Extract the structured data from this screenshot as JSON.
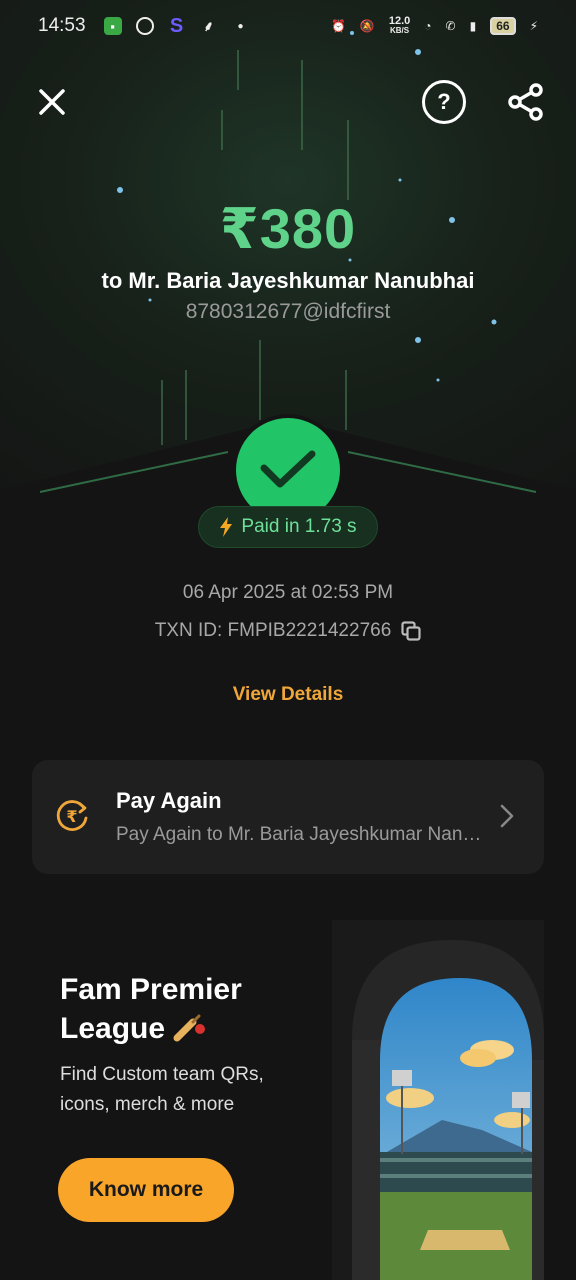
{
  "status_bar": {
    "time": "14:53",
    "net_speed": "12.0",
    "net_unit": "KB/S",
    "battery": "66"
  },
  "header": {
    "close_icon": "close-icon",
    "help_icon": "help-icon",
    "share_icon": "share-icon"
  },
  "payment": {
    "amount": "₹380",
    "payee": "to Mr. Baria Jayeshkumar Nanubhai",
    "upi_id": "8780312677@idfcfirst",
    "status_badge": "Paid in 1.73 s",
    "date_time": "06 Apr 2025 at 02:53 PM",
    "txn_id": "TXN ID: FMPIB2221422766",
    "view_details": "View Details"
  },
  "pay_again": {
    "title": "Pay Again",
    "subtitle": "Pay Again to Mr. Baria Jayeshkumar Nanubhai"
  },
  "promo": {
    "title_line1": "Fam Premier",
    "title_line2": "League",
    "description": "Find Custom team QRs, icons, merch & more",
    "cta": "Know more"
  },
  "colors": {
    "amount_green": "#5fd38a",
    "success_green": "#21c467",
    "accent_orange": "#f8a52a",
    "background": "#141414",
    "card": "#1f1f1f"
  }
}
